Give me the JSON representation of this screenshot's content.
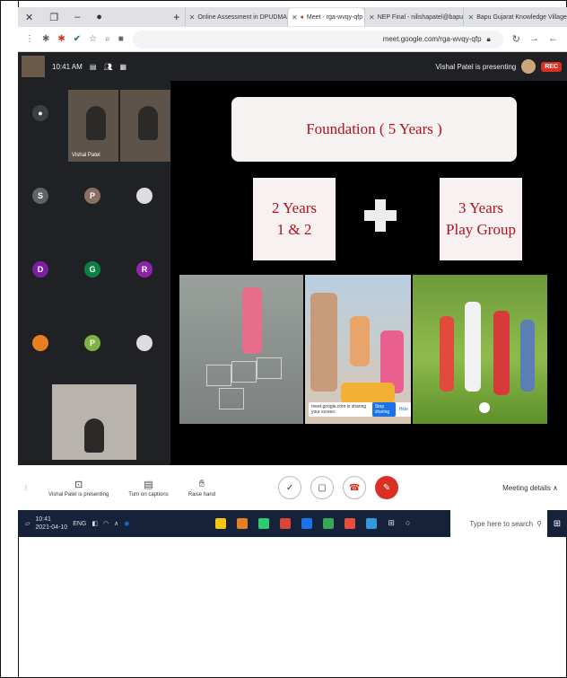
{
  "browser": {
    "tabs": [
      {
        "title": "Online Assessment in DPUDMA",
        "icon": "gmail-icon"
      },
      {
        "title": "Meet - rga-wvqy-qfp",
        "icon": "meet-icon",
        "active": true
      },
      {
        "title": "NEP Final - nilishapatel@bapu",
        "icon": "gmail-icon"
      },
      {
        "title": "Bapu Gujarat Knowledge Village",
        "icon": "site-icon"
      }
    ],
    "url": "meet.google.com/rga-wvqy-qfp"
  },
  "meet": {
    "time": "10:41 AM",
    "presenting": "Vishal Patel is presenting",
    "rec": "REC",
    "participants": [
      {
        "initial": "S",
        "color": "#5f6368"
      },
      {
        "initial": "P",
        "color": "#8d6e63"
      },
      {
        "initial": "D",
        "color": "#7b1fa2"
      },
      {
        "initial": "G",
        "color": "#0b8043"
      },
      {
        "initial": "R",
        "color": "#8e24aa"
      },
      {
        "initial": "P",
        "color": "#7cb342"
      }
    ],
    "video_label": "Vishal Patel"
  },
  "slide": {
    "title": "Foundation ( 5 Years )",
    "box_left": [
      "2 Years",
      "1 & 2"
    ],
    "box_right": [
      "3 Years",
      "Play Group"
    ],
    "share_text": "meet.google.com is sharing your screen.",
    "stop_sharing": "Stop sharing",
    "hide": "Hide"
  },
  "controls": {
    "presenting": "Vishal Patel is presenting",
    "captions": "Turn on captions",
    "raise": "Raise hand",
    "details": "Meeting details"
  },
  "taskbar": {
    "search": "Type here to search",
    "time": "10:41",
    "date": "2021-04-10",
    "lang": "ENG",
    "app_colors": [
      "#f2c811",
      "#e67e22",
      "#2ecc71",
      "#db4437",
      "#1a73e8",
      "#34a853",
      "#e74c3c",
      "#3498db"
    ]
  }
}
